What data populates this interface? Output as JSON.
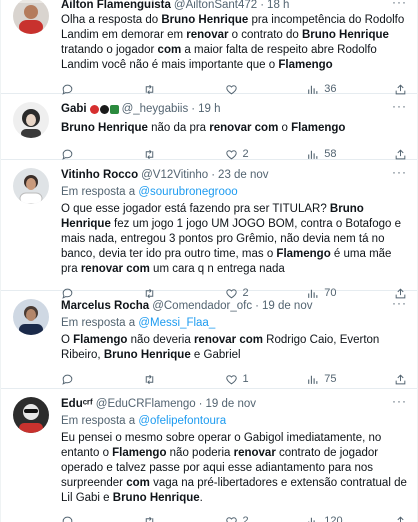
{
  "tweets": [
    {
      "name": "Ailton Flamenguista",
      "handle": "@AiltonSant472",
      "time": "18 h",
      "reply_prefix": "",
      "reply_to": "",
      "text_html": "Olha a resposta do <b>Bruno Henrique</b> pra incompetência do Rodolfo Landim em demorar em <b>renovar</b> o contrato do <b>Bruno Henrique</b> tratando o jogador <b>com</b> a maior falta de respeito abre Rodolfo Landim você não é mais importante que o <b>Flamengo</b>",
      "replies": "",
      "retweets": "",
      "likes": "",
      "views": "36"
    },
    {
      "name": "Gabi",
      "handle": "@_heygabiis",
      "time": "19 h",
      "reply_prefix": "",
      "reply_to": "",
      "text_html": "<b>Bruno Henrique</b> não da pra <b>renovar com</b> o <b>Flamengo</b>",
      "replies": "",
      "retweets": "",
      "likes": "2",
      "views": "58"
    },
    {
      "name": "Vitinho Rocco",
      "handle": "@V12Vitinho",
      "time": "23 de nov",
      "reply_prefix": "Em resposta a",
      "reply_to": "@sourubronegrooo",
      "text_html": "O que esse jogador está fazendo pra ser TITULAR? <b>Bruno Henrique</b> fez um jogo 1 jogo UM JOGO BOM, contra o Botafogo e mais nada, entregou 3 pontos pro Grêmio, não devia nem tá no banco, devia ter ido pra outro time, mas o <b>Flamengo</b> é uma mãe pra <b>renovar com</b> um cara q n entrega nada",
      "replies": "",
      "retweets": "",
      "likes": "2",
      "views": "70"
    },
    {
      "name": "Marcelus Rocha",
      "handle": "@Comendador_ofc",
      "time": "19 de nov",
      "reply_prefix": "Em resposta a",
      "reply_to": "@Messi_Flaa_",
      "text_html": "O <b>Flamengo</b> não deveria <b>renovar com</b> Rodrigo Caio, Everton Ribeiro, <b>Bruno Henrique</b> e Gabriel",
      "replies": "",
      "retweets": "",
      "likes": "1",
      "views": "75"
    },
    {
      "name": "Eduᶜʳᶠ",
      "handle": "@EduCRFlamengo",
      "time": "19 de nov",
      "reply_prefix": "Em resposta a",
      "reply_to": "@ofelipefontoura",
      "text_html": "Eu pensei o mesmo sobre operar o Gabigol imediatamente, no entanto o <b>Flamengo</b> não poderia <b>renovar</b> contrato de jogador operado e talvez passe por aqui esse adiantamento para nos surpreender <b>com</b> vaga na pré-libertadores e extensão contratual de Lil Gabi e <b>Bruno Henrique</b>.",
      "replies": "",
      "retweets": "",
      "likes": "2",
      "views": "120"
    }
  ],
  "colors": {
    "link": "#1d9bf0",
    "secondary_text": "#536471",
    "primary_text": "#0f1419",
    "divider": "#e6ecf0"
  },
  "icons": [
    "reply-icon",
    "retweet-icon",
    "like-icon",
    "views-icon",
    "share-icon",
    "more-icon"
  ]
}
